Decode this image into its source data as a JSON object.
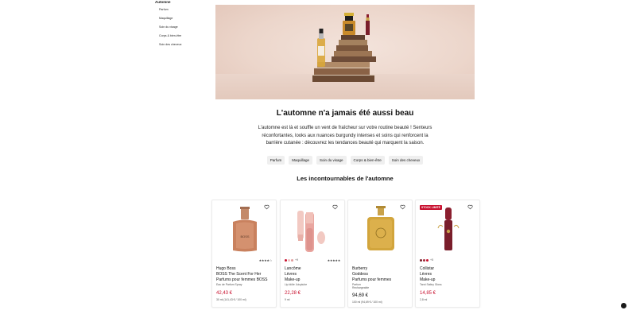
{
  "sidebar": {
    "title": "Automne",
    "items": [
      {
        "label": "Parfum"
      },
      {
        "label": "Maquillage"
      },
      {
        "label": "Soin du visage"
      },
      {
        "label": "Corps & bien-être"
      },
      {
        "label": "Soin des cheveux"
      }
    ]
  },
  "hero": {
    "headline": "L'automne n'a jamais été aussi beau",
    "intro": "L'automne est là et souffle un vent de fraîcheur sur votre routine beauté ! Senteurs réconfortantes, looks aux nuances burgundy intenses et soins qui renforcent la barrière cutanée : découvrez les tendances beauté qui marquent la saison."
  },
  "chips": [
    {
      "label": "Parfum"
    },
    {
      "label": "Maquillage"
    },
    {
      "label": "Soin du visage"
    },
    {
      "label": "Corps & bien-être"
    },
    {
      "label": "Soin des cheveux"
    }
  ],
  "section_title": "Les incontournables de l'automne",
  "products": [
    {
      "brand": "Hugo Boss",
      "name": "BOSS The Scent For Her",
      "type": "Parfums pour femmes BOSS",
      "sub": "Eau de Parfum Spray",
      "price": "42,43 €",
      "unit": "30 ml (141,43 € / 100 ml)",
      "rating": "★★★★☆",
      "price_color": "#c8102e"
    },
    {
      "brand": "Lancôme",
      "name": "Lèvres",
      "type": "Make-up",
      "sub": "Lip Idôle Juicytube",
      "price": "22,28 €",
      "unit": "9 ml",
      "rating": "★★★★★",
      "more": "+9",
      "price_color": "#c8102e"
    },
    {
      "brand": "Burberry",
      "name": "Goddess",
      "type": "Parfums pour femmes",
      "sub": "Parfum",
      "sub2": "Rechargeable",
      "price": "94,69 €",
      "unit": "100 ml (94,69 € / 100 ml)",
      "price_color": "#111111"
    },
    {
      "brand": "Collistar",
      "name": "Lèvres",
      "type": "Make-up",
      "sub": "Tarot Satiny Gloss",
      "price": "14,85 €",
      "unit": "2,8 ml",
      "badge": "STOCK LIMITÉ",
      "more": "+5",
      "price_color": "#c8102e"
    }
  ]
}
